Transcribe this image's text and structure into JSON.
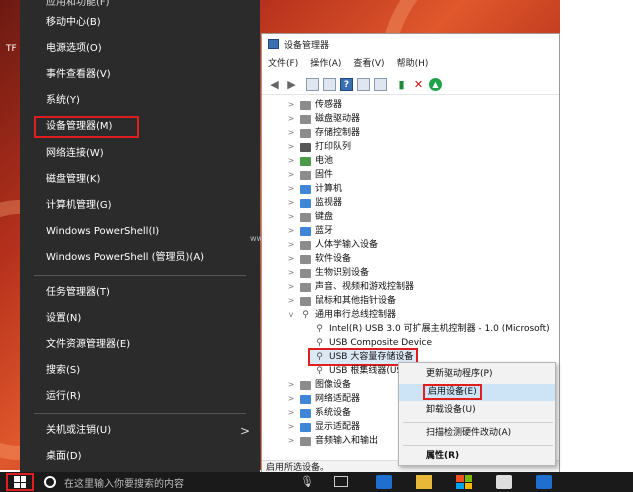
{
  "desktop": {
    "left_label": "TF",
    "blur_label": "www"
  },
  "winx_menu": {
    "items": [
      {
        "label": "应用和功能(F)"
      },
      {
        "label": "移动中心(B)"
      },
      {
        "label": "电源选项(O)"
      },
      {
        "label": "事件查看器(V)"
      },
      {
        "label": "系统(Y)"
      },
      {
        "label": "设备管理器(M)",
        "highlighted": true
      },
      {
        "label": "网络连接(W)"
      },
      {
        "label": "磁盘管理(K)"
      },
      {
        "label": "计算机管理(G)"
      },
      {
        "label": "Windows PowerShell(I)"
      },
      {
        "label": "Windows PowerShell (管理员)(A)"
      },
      {
        "label": "任务管理器(T)"
      },
      {
        "label": "设置(N)"
      },
      {
        "label": "文件资源管理器(E)"
      },
      {
        "label": "搜索(S)"
      },
      {
        "label": "运行(R)"
      },
      {
        "label": "关机或注销(U)",
        "submenu_arrow": ">"
      },
      {
        "label": "桌面(D)"
      }
    ]
  },
  "device_manager": {
    "title": "设备管理器",
    "menu": [
      "文件(F)",
      "操作(A)",
      "查看(V)",
      "帮助(H)"
    ],
    "toolbar_icons": [
      "back-arrow-icon",
      "forward-arrow-icon",
      "properties-icon",
      "view-icon",
      "help-icon",
      "view-list-icon",
      "monitor-icon",
      "update-driver-icon",
      "uninstall-x-icon",
      "enable-device-icon"
    ],
    "tree": [
      {
        "label": "传感器",
        "expander": ">",
        "icon": "gray"
      },
      {
        "label": "磁盘驱动器",
        "expander": ">",
        "icon": "gray"
      },
      {
        "label": "存储控制器",
        "expander": ">",
        "icon": "gray"
      },
      {
        "label": "打印队列",
        "expander": ">",
        "icon": "dark"
      },
      {
        "label": "电池",
        "expander": ">",
        "icon": "green"
      },
      {
        "label": "固件",
        "expander": ">",
        "icon": "gray"
      },
      {
        "label": "计算机",
        "expander": ">",
        "icon": "blue"
      },
      {
        "label": "监视器",
        "expander": ">",
        "icon": "blue"
      },
      {
        "label": "键盘",
        "expander": ">",
        "icon": "gray"
      },
      {
        "label": "蓝牙",
        "expander": ">",
        "icon": "blue"
      },
      {
        "label": "人体学输入设备",
        "expander": ">",
        "icon": "gray"
      },
      {
        "label": "软件设备",
        "expander": ">",
        "icon": "gray"
      },
      {
        "label": "生物识别设备",
        "expander": ">",
        "icon": "gray"
      },
      {
        "label": "声音、视频和游戏控制器",
        "expander": ">",
        "icon": "gray"
      },
      {
        "label": "鼠标和其他指针设备",
        "expander": ">",
        "icon": "gray"
      },
      {
        "label": "通用串行总线控制器",
        "expander": "v",
        "icon": "usb"
      },
      {
        "label": "Intel(R) USB 3.0 可扩展主机控制器 - 1.0 (Microsoft)",
        "child": true,
        "icon": "usb"
      },
      {
        "label": "USB Composite Device",
        "child": true,
        "icon": "usb"
      },
      {
        "label": "USB 大容量存储设备",
        "child": true,
        "icon": "usb",
        "selected": true
      },
      {
        "label": "USB 根集线器(US",
        "child": true,
        "icon": "usb"
      },
      {
        "label": "图像设备",
        "expander": ">",
        "icon": "gray"
      },
      {
        "label": "网络适配器",
        "expander": ">",
        "icon": "blue"
      },
      {
        "label": "系统设备",
        "expander": ">",
        "icon": "blue"
      },
      {
        "label": "显示适配器",
        "expander": ">",
        "icon": "blue"
      },
      {
        "label": "音频输入和输出",
        "expander": ">",
        "icon": "gray"
      }
    ],
    "status": "启用所选设备。"
  },
  "context_menu": {
    "items": [
      {
        "label": "更新驱动程序(P)"
      },
      {
        "label": "启用设备(E)",
        "hover": true,
        "boxed": true
      },
      {
        "label": "卸载设备(U)"
      },
      {
        "label": "扫描检测硬件改动(A)"
      },
      {
        "label": "属性(R)",
        "bold": true
      }
    ]
  },
  "taskbar": {
    "search_placeholder": "在这里输入你要搜索的内容"
  },
  "colors": {
    "highlight_border": "#e01e1e",
    "menu_bg": "#2b2b2b",
    "selection": "#cde4f7"
  }
}
